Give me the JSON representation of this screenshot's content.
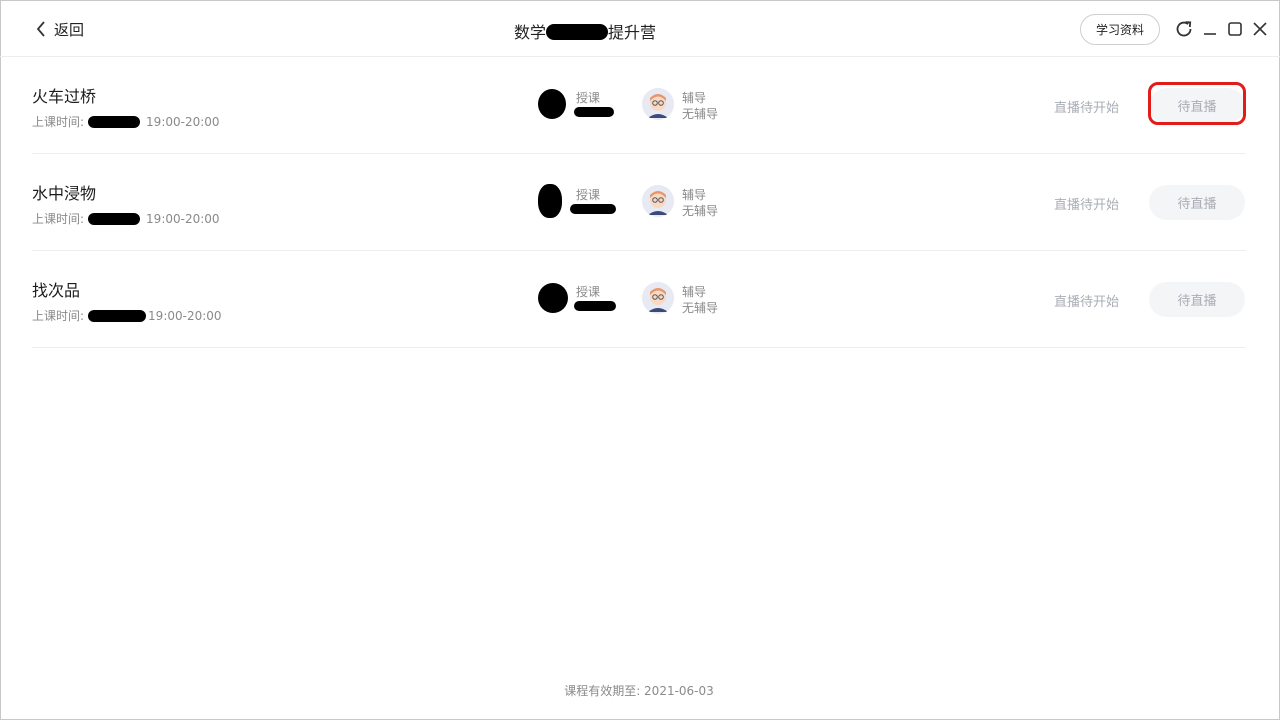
{
  "header": {
    "back_label": "返回",
    "title_prefix": "数学",
    "title_suffix": "提升营",
    "materials_label": "学习资料"
  },
  "lessons": [
    {
      "title": "火车过桥",
      "time_label": "上课时间:",
      "time": "19:00-20:00",
      "teacher_role": "授课",
      "tutor_role": "辅导",
      "tutor_name": "无辅导",
      "status": "直播待开始",
      "action": "待直播"
    },
    {
      "title": "水中浸物",
      "time_label": "上课时间:",
      "time": "19:00-20:00",
      "teacher_role": "授课",
      "tutor_role": "辅导",
      "tutor_name": "无辅导",
      "status": "直播待开始",
      "action": "待直播"
    },
    {
      "title": "找次品",
      "time_label": "上课时间:",
      "time": "19:00-20:00",
      "teacher_role": "授课",
      "tutor_role": "辅导",
      "tutor_name": "无辅导",
      "status": "直播待开始",
      "action": "待直播"
    }
  ],
  "footer": {
    "validity": "课程有效期至: 2021-06-03"
  },
  "colors": {
    "annotation": "#e21b1b",
    "muted_text": "#a9adb5",
    "button_bg": "#f4f5f7"
  },
  "icons": [
    "back-chevron-icon",
    "refresh-icon",
    "minimize-icon",
    "maximize-icon",
    "close-icon",
    "tutor-avatar-icon"
  ]
}
